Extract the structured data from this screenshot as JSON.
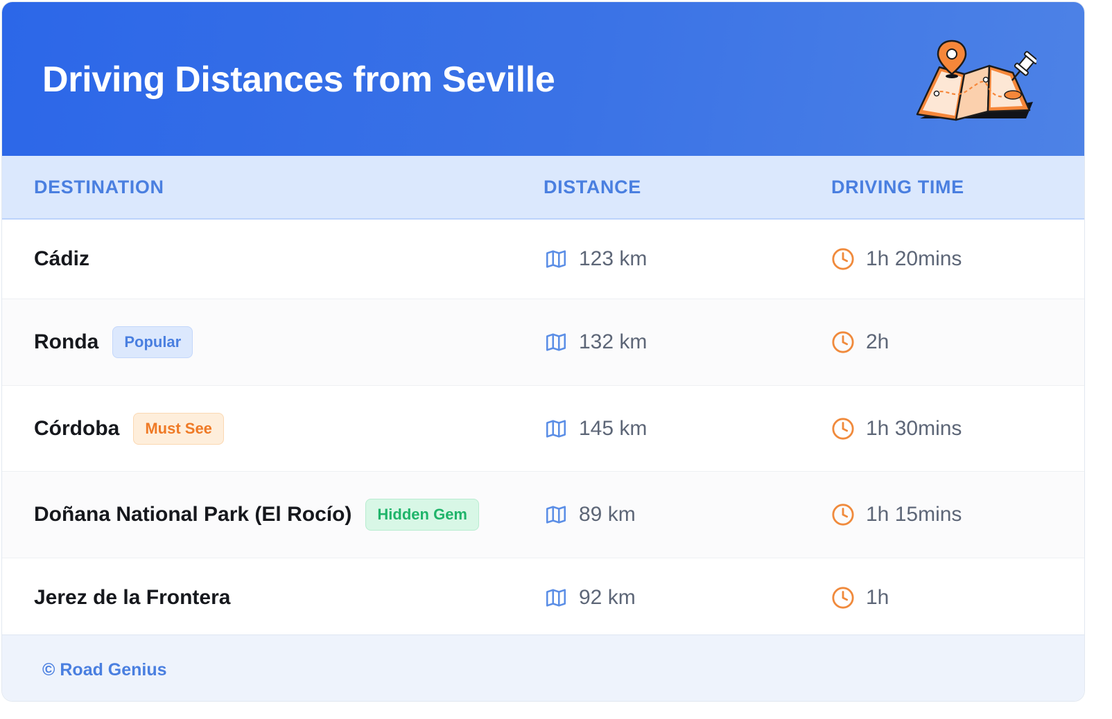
{
  "header": {
    "title": "Driving Distances from Seville",
    "illustration_icon": "folded-map-with-pins-icon"
  },
  "columns": {
    "destination": "DESTINATION",
    "distance": "DISTANCE",
    "driving_time": "DRIVING TIME"
  },
  "rows": [
    {
      "destination": "Cádiz",
      "badge": "",
      "distance": "123 km",
      "time": "1h 20mins"
    },
    {
      "destination": "Ronda",
      "badge": "Popular",
      "badge_type": "popular",
      "distance": "132 km",
      "time": "2h"
    },
    {
      "destination": "Córdoba",
      "badge": "Must See",
      "badge_type": "mustsee",
      "distance": "145 km",
      "time": "1h 30mins"
    },
    {
      "destination": "Doñana National Park (El Rocío)",
      "badge": "Hidden Gem",
      "badge_type": "hidden",
      "distance": "89 km",
      "time": "1h 15mins"
    },
    {
      "destination": "Jerez de la Frontera",
      "badge": "",
      "distance": "92 km",
      "time": "1h"
    }
  ],
  "icons": {
    "distance": "map-icon",
    "time": "clock-icon"
  },
  "colors": {
    "header_gradient_start": "#2c67e8",
    "header_gradient_end": "#4d82e6",
    "accent_blue": "#4a7fe0",
    "accent_orange": "#ef7a26",
    "accent_green": "#1fb46a"
  },
  "footer": {
    "copyright": "© Road Genius"
  }
}
